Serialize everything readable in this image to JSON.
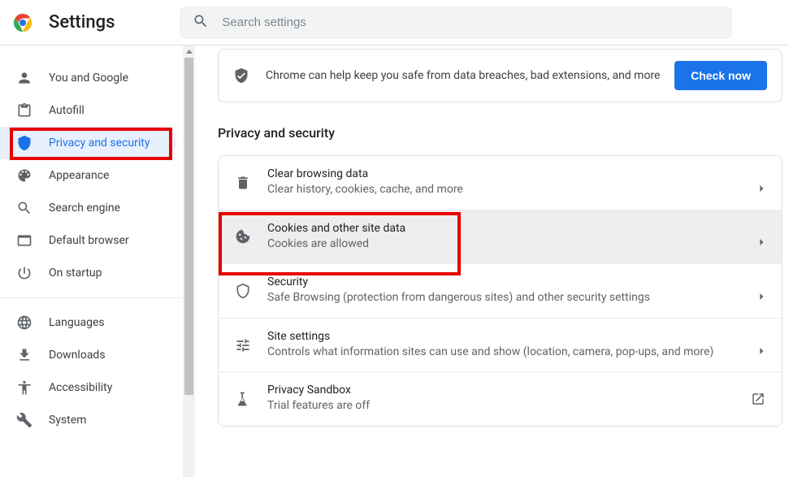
{
  "header": {
    "title": "Settings",
    "search_placeholder": "Search settings"
  },
  "sidebar": {
    "section1": [
      {
        "label": "You and Google"
      },
      {
        "label": "Autofill"
      },
      {
        "label": "Privacy and security"
      },
      {
        "label": "Appearance"
      },
      {
        "label": "Search engine"
      },
      {
        "label": "Default browser"
      },
      {
        "label": "On startup"
      }
    ],
    "section2": [
      {
        "label": "Languages"
      },
      {
        "label": "Downloads"
      },
      {
        "label": "Accessibility"
      },
      {
        "label": "System"
      }
    ]
  },
  "banner": {
    "text": "Chrome can help keep you safe from data breaches, bad extensions, and more",
    "button": "Check now"
  },
  "section_title": "Privacy and security",
  "rows": [
    {
      "title": "Clear browsing data",
      "subtitle": "Clear history, cookies, cache, and more"
    },
    {
      "title": "Cookies and other site data",
      "subtitle": "Cookies are allowed"
    },
    {
      "title": "Security",
      "subtitle": "Safe Browsing (protection from dangerous sites) and other security settings"
    },
    {
      "title": "Site settings",
      "subtitle": "Controls what information sites can use and show (location, camera, pop-ups, and more)"
    },
    {
      "title": "Privacy Sandbox",
      "subtitle": "Trial features are off"
    }
  ]
}
